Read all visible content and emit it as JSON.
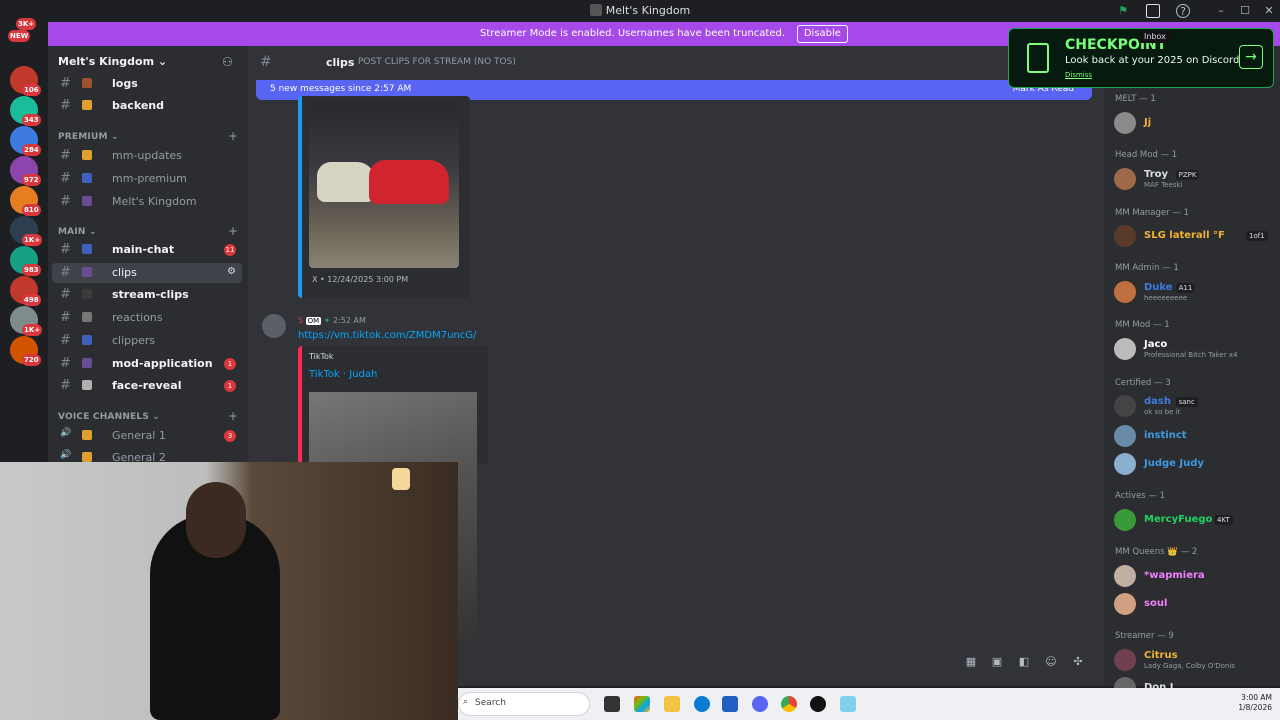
{
  "window": {
    "title": "Melt's Kingdom",
    "inbox_tooltip": "Inbox"
  },
  "banner": {
    "message": "Streamer Mode is enabled. Usernames have been truncated.",
    "disable_label": "Disable"
  },
  "server_rail": {
    "top_badge": "3K+",
    "new_label": "NEW",
    "badges": [
      "106",
      "343",
      "284",
      "972",
      "810",
      "1K+",
      "983",
      "498",
      "1K+",
      "720"
    ]
  },
  "server": {
    "name": "Melt's Kingdom"
  },
  "channels_top": [
    {
      "name": "logs"
    },
    {
      "name": "backend"
    }
  ],
  "categories": {
    "premium": "PREMIUM",
    "main": "MAIN",
    "voice": "VOICE CHANNELS"
  },
  "premium_channels": [
    {
      "name": "mm-updates"
    },
    {
      "name": "mm-premium"
    },
    {
      "name": "Melt's Kingdom"
    }
  ],
  "main_channels": [
    {
      "name": "main-chat",
      "badge": "11"
    },
    {
      "name": "clips",
      "badge": ""
    },
    {
      "name": "stream-clips",
      "badge": ""
    },
    {
      "name": "reactions",
      "badge": ""
    },
    {
      "name": "clippers",
      "badge": ""
    },
    {
      "name": "mod-application",
      "badge": "1"
    },
    {
      "name": "face-reveal",
      "badge": "1"
    }
  ],
  "voice_channels": [
    {
      "name": "General 1",
      "badge": "3"
    },
    {
      "name": "General 2",
      "badge": ""
    }
  ],
  "channel": {
    "name": "clips",
    "topic": "POST CLIPS FOR STREAM (NO TOS)"
  },
  "new_messages": {
    "text": "5 new messages since 2:57 AM",
    "mark_read": "Mark As Read"
  },
  "messages": {
    "embed1_footer": "X • 12/24/2025 3:00 PM",
    "author_tag": "OM",
    "time": "2:52 AM",
    "link": "https://vm.tiktok.com/ZMDM7uncG/",
    "embed2_provider": "TikTok",
    "embed2_title": "TikTok · Judah"
  },
  "promo": {
    "heading": "CHECKPOINT",
    "subtitle": "Look back at your 2025 on Discord",
    "dismiss": "Dismiss"
  },
  "members": {
    "roles": [
      {
        "label": "MELT — 1"
      },
      {
        "label": "Head Mod — 1"
      },
      {
        "label": "MM Manager — 1"
      },
      {
        "label": "MM Admin — 1"
      },
      {
        "label": "MM Mod — 1"
      },
      {
        "label": "Certified — 3"
      },
      {
        "label": "Actives — 1"
      },
      {
        "label": "MM Queens 👑 — 2"
      },
      {
        "label": "Streamer — 9"
      }
    ],
    "list": [
      {
        "name": "Jj",
        "color": "#f0b232",
        "status": "",
        "tag": ""
      },
      {
        "name": "Troy",
        "color": "#dbdee1",
        "status": "MAF Teeski",
        "tag": "PZPK"
      },
      {
        "name": "SLG laterall °F",
        "color": "#f0b232",
        "status": "",
        "tag": "1of1"
      },
      {
        "name": "Duke",
        "color": "#3e7be0",
        "status": "heeeeeeeee",
        "tag": "A11"
      },
      {
        "name": "Jaco",
        "color": "#ffffff",
        "status": "Professional Bitch Taker x4",
        "tag": ""
      },
      {
        "name": "dash",
        "color": "#3e7be0",
        "status": "ok so be it",
        "tag": "sanc"
      },
      {
        "name": "instinct",
        "color": "#3e9be0",
        "status": "",
        "tag": ""
      },
      {
        "name": "Judge Judy",
        "color": "#3e9be0",
        "status": "",
        "tag": ""
      },
      {
        "name": "MercyFuego",
        "color": "#23d160",
        "status": "",
        "tag": "4KT"
      },
      {
        "name": "*wapmiera",
        "color": "#f47fff",
        "status": "",
        "tag": ""
      },
      {
        "name": "soul",
        "color": "#f47fff",
        "status": "",
        "tag": ""
      },
      {
        "name": "Citrus",
        "color": "#f0b232",
        "status": "Lady Gaga, Colby O'Donis",
        "tag": ""
      },
      {
        "name": "Don L",
        "color": "#dbdee1",
        "status": "",
        "tag": ""
      }
    ]
  },
  "taskbar": {
    "search_placeholder": "Search",
    "time": "3:00 AM",
    "date": "1/8/2026"
  },
  "colors": {
    "accent": "#5865f2",
    "banner": "#a549e8",
    "promo": "#7aff7a"
  }
}
